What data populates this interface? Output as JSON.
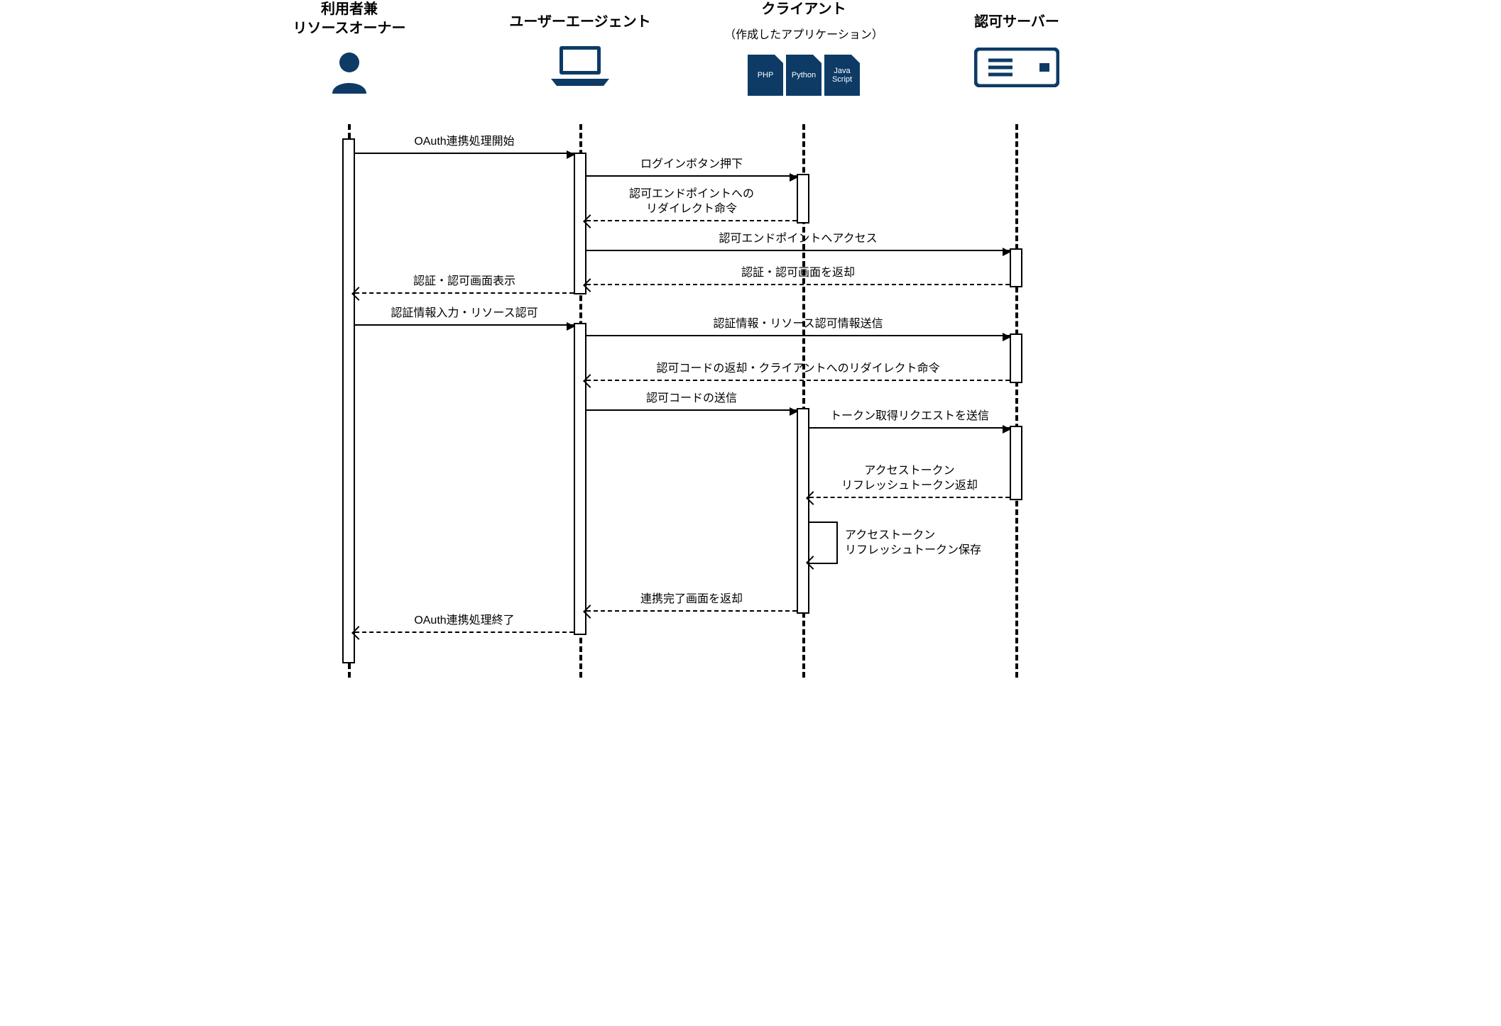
{
  "participants": {
    "user": {
      "title_line1": "利用者兼",
      "title_line2": "リソースオーナー"
    },
    "agent": {
      "title": "ユーザーエージェント"
    },
    "client": {
      "title": "クライアント",
      "subtitle": "（作成したアプリケーション）",
      "file1": "PHP",
      "file2": "Python",
      "file3": "Java\nScript"
    },
    "server": {
      "title": "認可サーバー"
    }
  },
  "messages": {
    "m1": "OAuth連携処理開始",
    "m2": "ログインボタン押下",
    "m3a": "認可エンドポイントへの",
    "m3b": "リダイレクト命令",
    "m4": "認可エンドポイントへアクセス",
    "m5": "認証・認可画面を返却",
    "m6": "認証・認可画面表示",
    "m7": "認証情報入力・リソース認可",
    "m8": "認証情報・リソース認可情報送信",
    "m9": "認可コードの返却・クライアントへのリダイレクト命令",
    "m10": "認可コードの送信",
    "m11": "トークン取得リクエストを送信",
    "m12a": "アクセストークン",
    "m12b": "リフレッシュトークン返却",
    "m13a": "アクセストークン",
    "m13b": "リフレッシュトークン保存",
    "m14": "連携完了画面を返却",
    "m15": "OAuth連携処理終了"
  }
}
